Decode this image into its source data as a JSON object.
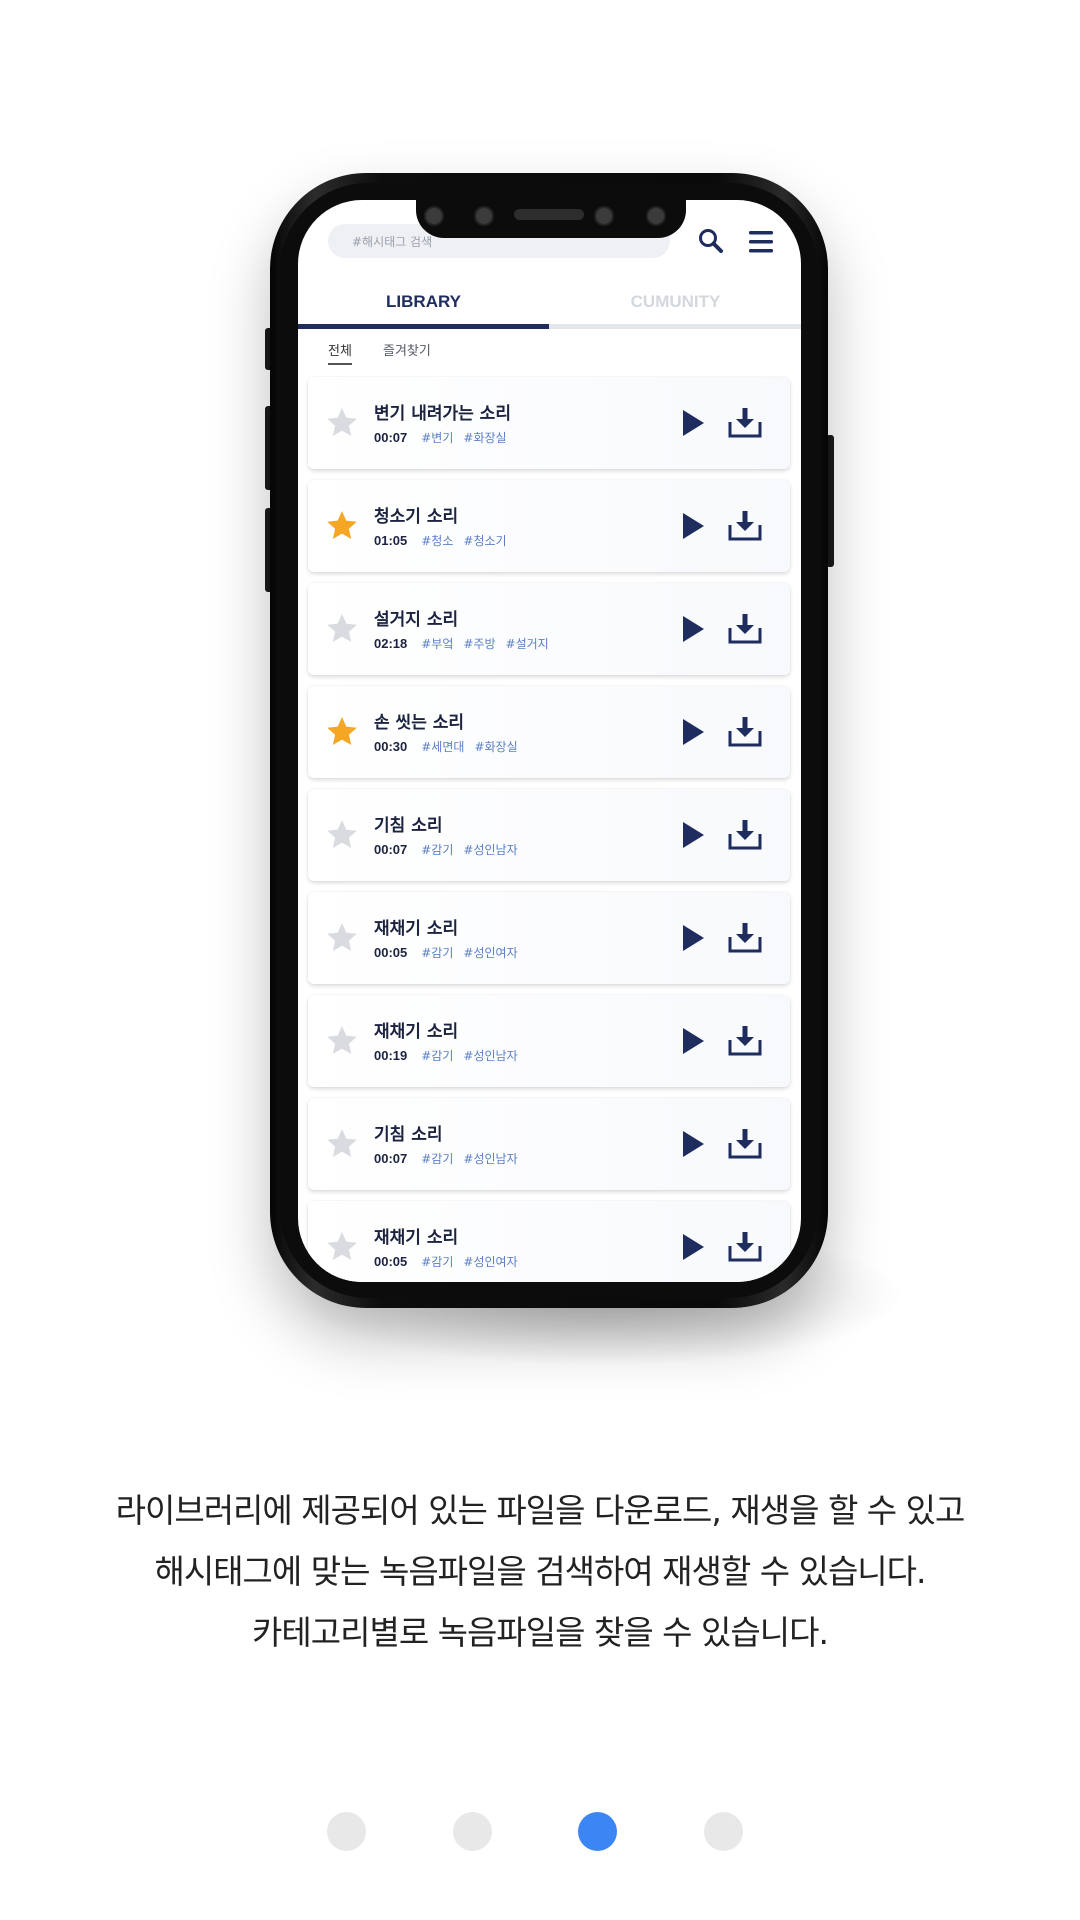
{
  "app": {
    "search": {
      "placeholder": "#해시태그 검색"
    },
    "tabs": [
      {
        "label": "LIBRARY",
        "active": true,
        "color": "#1e2c5e"
      },
      {
        "label": "CUMUNITY",
        "active": false,
        "color": "#d3d7de"
      }
    ],
    "filters": [
      {
        "label": "전체",
        "active": true
      },
      {
        "label": "즐겨찾기",
        "active": false
      }
    ],
    "items": [
      {
        "title": "변기 내려가는 소리",
        "time": "00:07",
        "tags": [
          "#변기",
          "#화장실"
        ],
        "favorite": false
      },
      {
        "title": "청소기 소리",
        "time": "01:05",
        "tags": [
          "#청소",
          "#청소기"
        ],
        "favorite": true
      },
      {
        "title": "설거지 소리",
        "time": "02:18",
        "tags": [
          "#부엌",
          "#주방",
          "#설거지"
        ],
        "favorite": false
      },
      {
        "title": "손 씻는 소리",
        "time": "00:30",
        "tags": [
          "#세면대",
          "#화장실"
        ],
        "favorite": true
      },
      {
        "title": "기침 소리",
        "time": "00:07",
        "tags": [
          "#감기",
          "#성인남자"
        ],
        "favorite": false
      },
      {
        "title": "재채기 소리",
        "time": "00:05",
        "tags": [
          "#감기",
          "#성인여자"
        ],
        "favorite": false
      },
      {
        "title": "재채기 소리",
        "time": "00:19",
        "tags": [
          "#감기",
          "#성인남자"
        ],
        "favorite": false
      },
      {
        "title": "기침 소리",
        "time": "00:07",
        "tags": [
          "#감기",
          "#성인남자"
        ],
        "favorite": false
      },
      {
        "title": "재채기 소리",
        "time": "00:05",
        "tags": [
          "#감기",
          "#성인여자"
        ],
        "favorite": false
      }
    ],
    "icons": {
      "search": "search-icon",
      "menu": "hamburger-menu-icon",
      "star": "star-icon",
      "play": "play-icon",
      "download": "download-icon"
    },
    "colors": {
      "navy": "#1e2c5e",
      "star_on": "#f5a623",
      "star_off": "#d9dbe0",
      "tag": "#5b7fc4"
    }
  },
  "caption": {
    "line1": "라이브러리에 제공되어 있는 파일을 다운로드, 재생을 할 수 있고",
    "line2": "해시태그에 맞는 녹음파일을 검색하여 재생할 수 있습니다.",
    "line3": "카테고리별로 녹음파일을 찾을 수 있습니다."
  },
  "pagination": {
    "total": 4,
    "current": 3,
    "active_color": "#3b86f4",
    "inactive_color": "#e8e8e8"
  }
}
